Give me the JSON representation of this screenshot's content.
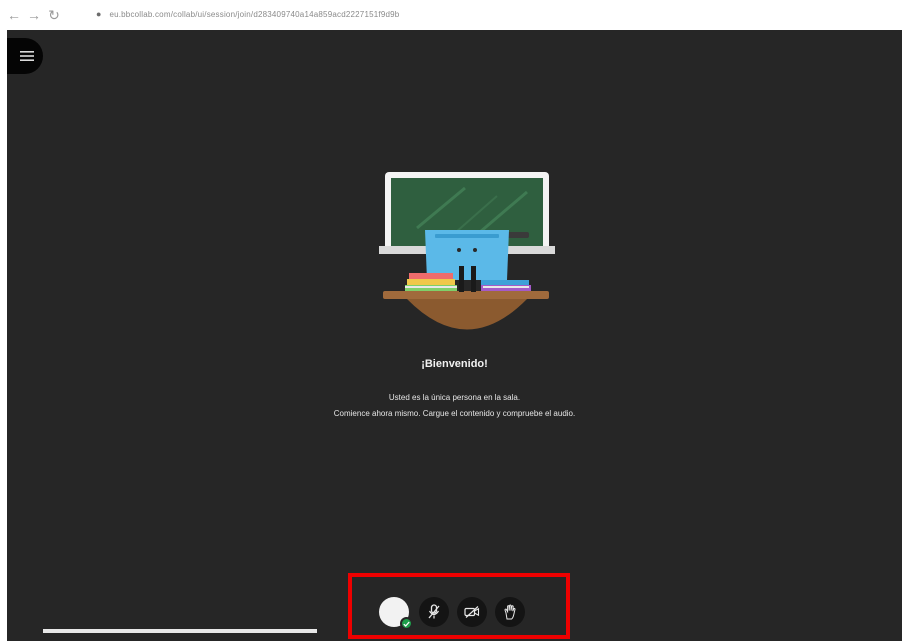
{
  "browser": {
    "url": "eu.bbcollab.com/collab/ui/session/join/d283409740a14a859acd2227151f9d9b",
    "icons": [
      "back-arrow-icon",
      "forward-arrow-icon",
      "reload-icon",
      "lock-icon"
    ]
  },
  "app": {
    "menu_icon": "hamburger-menu-icon",
    "welcome": {
      "title": "¡Bienvenido!",
      "line1": "Usted es la única persona en la sala.",
      "line2": "Comience ahora mismo. Cargue el contenido y compruebe el audio."
    },
    "controls": {
      "items": [
        "avatar",
        "microphone-muted-icon",
        "camera-muted-icon",
        "raise-hand-icon"
      ],
      "status": "available"
    }
  },
  "colors": {
    "background": "#262626",
    "highlight": "#ee0000",
    "status": "#1e9e4a"
  }
}
